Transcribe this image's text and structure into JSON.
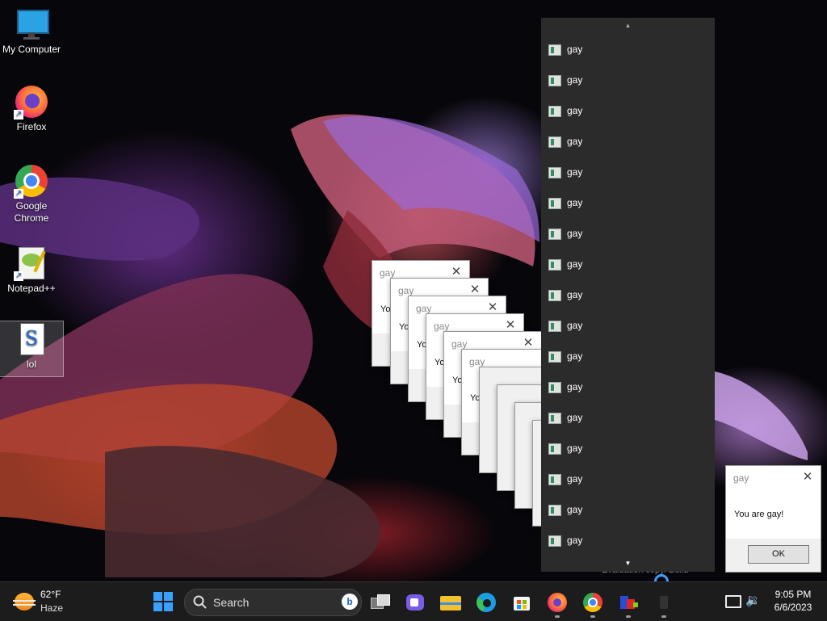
{
  "desktop_icons": [
    {
      "label": "My Computer"
    },
    {
      "label": "Firefox"
    },
    {
      "label": "Google Chrome"
    },
    {
      "label": "Notepad++"
    },
    {
      "label": "lol"
    }
  ],
  "message_box": {
    "title": "gay",
    "text": "You are gay!",
    "text_partial": "Yo",
    "ok_label": "OK"
  },
  "panel": {
    "items": [
      "gay",
      "gay",
      "gay",
      "gay",
      "gay",
      "gay",
      "gay",
      "gay",
      "gay",
      "gay",
      "gay",
      "gay",
      "gay",
      "gay",
      "gay",
      "gay",
      "gay"
    ]
  },
  "watermark": "Evaluation copy. Build",
  "taskbar": {
    "weather_temp": "62°F",
    "weather_desc": "Haze",
    "search_placeholder": "Search",
    "time": "9:05 PM",
    "date": "6/6/2023"
  },
  "colors": {
    "taskbar_bg": "#1c1c1c",
    "panel_bg": "#2b2b2b",
    "start_blue": "#3aa0ff"
  }
}
